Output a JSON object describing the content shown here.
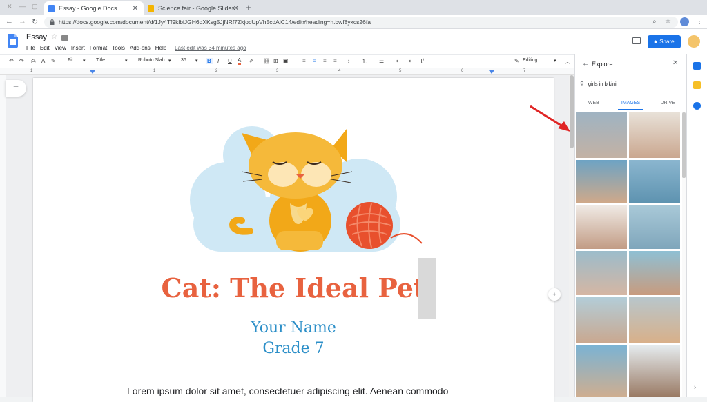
{
  "browser": {
    "tabs": [
      {
        "title": "Essay - Google Docs",
        "color": "#4285f4"
      },
      {
        "title": "Science fair - Google Slides",
        "color": "#f4b400"
      }
    ],
    "url": "https://docs.google.com/document/d/1Jy4Tf9klbiJGH6qXKsg5JjNRf7ZkjocUpVh5cdAiC14/edit#heading=h.bwf8yxcs26fa"
  },
  "docs": {
    "title": "Essay",
    "menu": [
      "File",
      "Edit",
      "View",
      "Insert",
      "Format",
      "Tools",
      "Add-ons",
      "Help"
    ],
    "last_edit": "Last edit was 34 minutes ago",
    "share_label": "Share"
  },
  "toolbar": {
    "zoom": "Fit",
    "style": "Title",
    "font": "Roboto Slab",
    "size": "36",
    "mode": "Editing"
  },
  "ruler": [
    "1",
    "1",
    "2",
    "3",
    "4",
    "5",
    "6",
    "7"
  ],
  "document": {
    "title": "Cat: The Ideal Pet",
    "name": "Your Name",
    "grade": "Grade 7",
    "body": "Lorem ipsum dolor sit amet, consectetuer adipiscing elit. Aenean commodo"
  },
  "explore": {
    "title": "Explore",
    "query": "girls in bikini",
    "tabs": [
      "WEB",
      "IMAGES",
      "DRIVE"
    ],
    "active_tab": "IMAGES"
  },
  "colors": {
    "title": "#e8623f",
    "subtitle": "#2c8fc8",
    "accent": "#1a73e8",
    "annotation_arrow": "#e02424"
  }
}
